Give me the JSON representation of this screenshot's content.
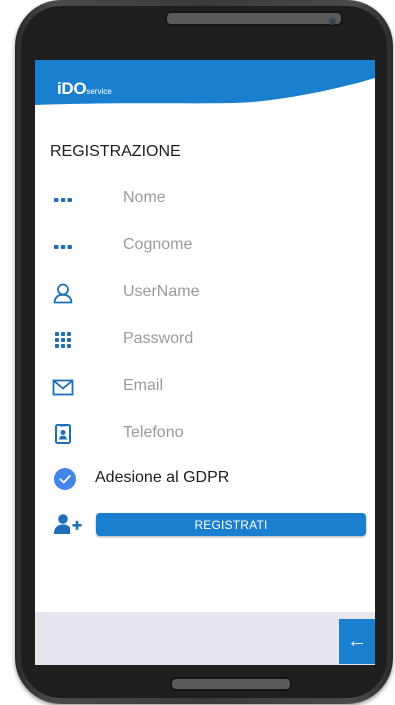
{
  "header": {
    "logo_main": "iDO",
    "logo_sub": "service",
    "brand_color": "#1a7fcf"
  },
  "form": {
    "title": "REGISTRAZIONE",
    "fields": [
      {
        "placeholder": "Nome",
        "icon": "dots-icon"
      },
      {
        "placeholder": "Cognome",
        "icon": "dots-icon"
      },
      {
        "placeholder": "UserName",
        "icon": "user-icon"
      },
      {
        "placeholder": "Password",
        "icon": "keypad-icon"
      },
      {
        "placeholder": "Email",
        "icon": "envelope-icon"
      },
      {
        "placeholder": "Telefono",
        "icon": "contact-card-icon"
      }
    ],
    "gdpr_label": "Adesione al GDPR",
    "gdpr_checked": true,
    "register_label": "REGISTRATI",
    "register_icon": "add-user-icon"
  },
  "footer": {
    "back_label": "←",
    "back_icon": "arrow-left-icon"
  }
}
